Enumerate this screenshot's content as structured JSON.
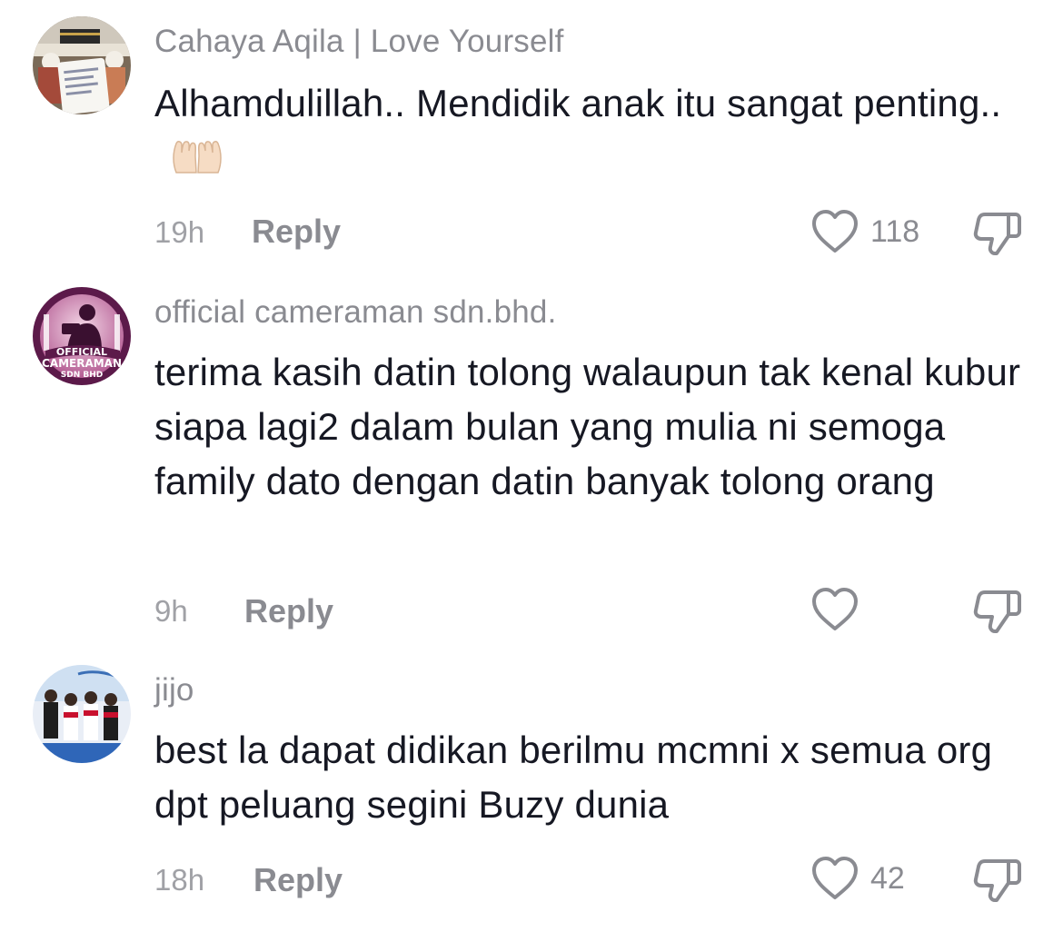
{
  "comments": [
    {
      "username": "Cahaya Aqila | Love Yourself",
      "text": "Alhamdulillah.. Mendidik anak itu sangat penting..",
      "emoji": "palms-up-together-emoji",
      "time": "19h",
      "reply_label": "Reply",
      "like_count": "118"
    },
    {
      "username": "official cameraman sdn.bhd.",
      "text": "terima kasih datin tolong walaupun tak kenal kubur siapa lagi2 dalam bulan yang mulia ni semoga family dato dengan datin banyak tolong orang",
      "time": "9h",
      "reply_label": "Reply",
      "like_count": "",
      "avatar_text": {
        "line1": "OFFICIAL",
        "line2": "CAMERAMAN",
        "line3": "SDN BHD"
      }
    },
    {
      "username": "jijo",
      "text": "best la dapat didikan berilmu mcmni x semua org dpt peluang segini Buzy dunia",
      "time": "18h",
      "reply_label": "Reply",
      "like_count": "42"
    }
  ],
  "icons": {
    "like": "heart-outline-icon",
    "dislike": "thumbs-down-outline-icon"
  },
  "colors": {
    "text": "#161823",
    "secondary": "#8a8b91",
    "avatar2_ring": "#5c1a4a"
  }
}
